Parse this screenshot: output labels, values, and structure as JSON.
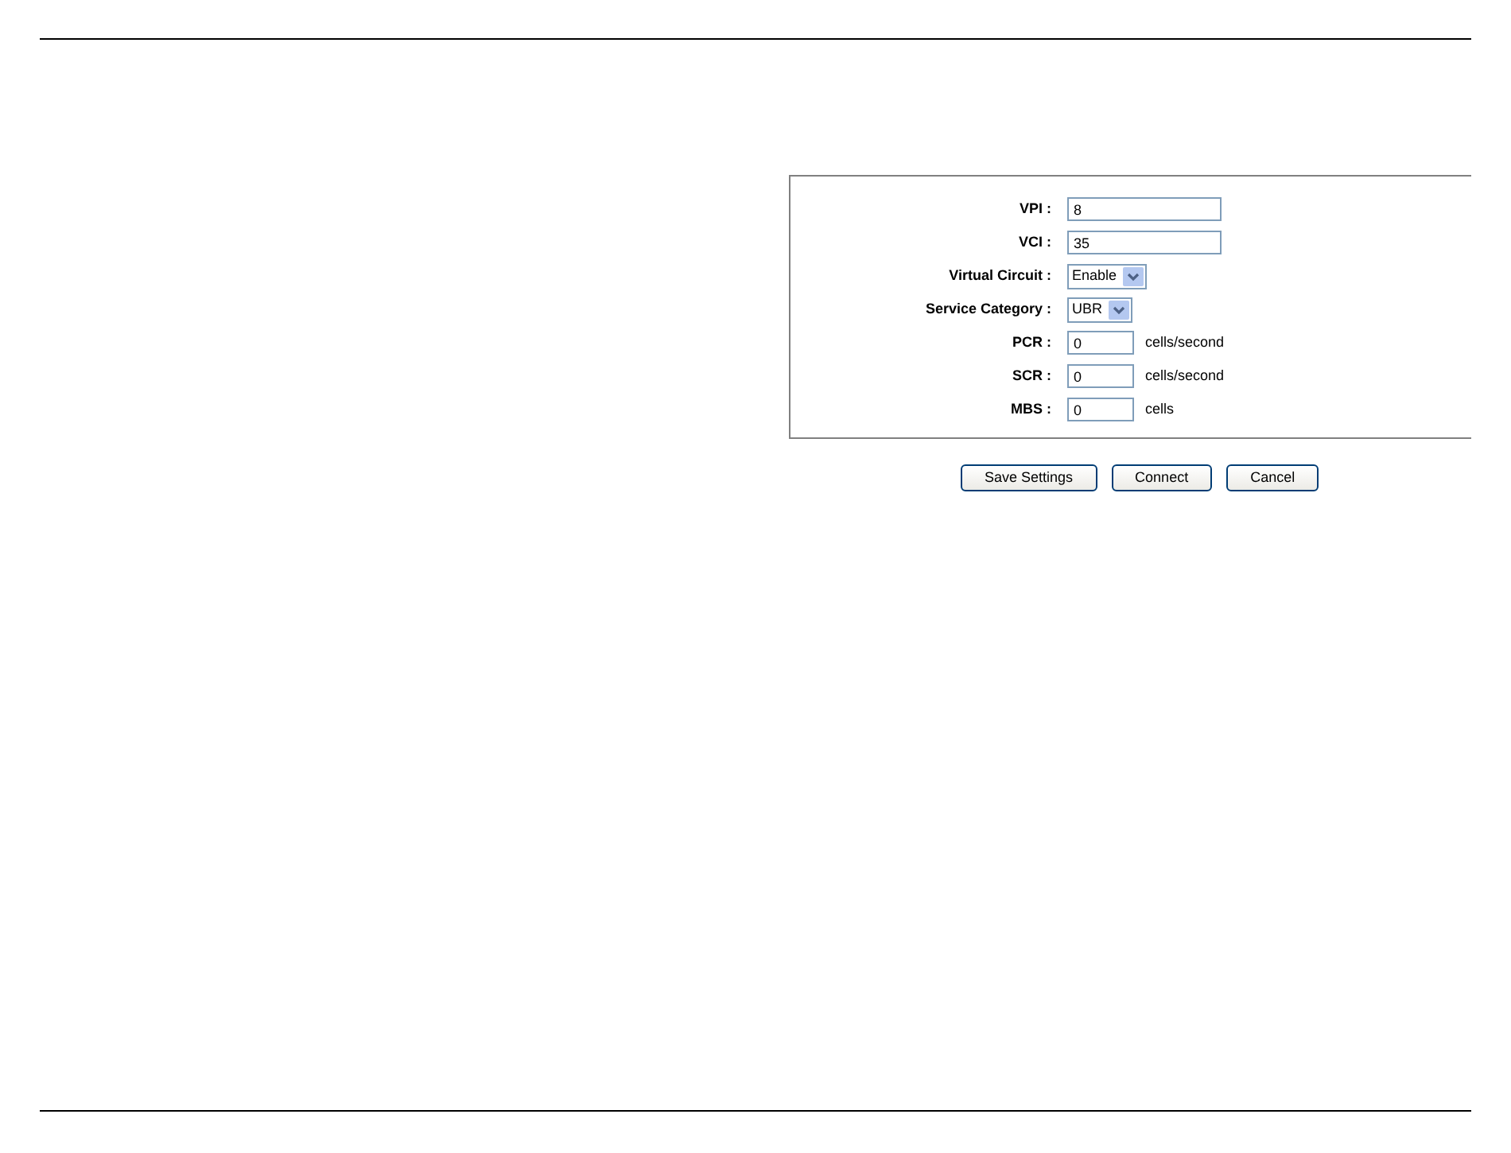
{
  "fields": [
    {
      "kind": "text",
      "label": "VPI :",
      "value": "8",
      "wide": true
    },
    {
      "kind": "text",
      "label": "VCI :",
      "value": "35",
      "wide": true
    },
    {
      "kind": "select",
      "label": "Virtual Circuit :",
      "value": "Enable"
    },
    {
      "kind": "select",
      "label": "Service Category :",
      "value": "UBR"
    },
    {
      "kind": "text",
      "label": "PCR :",
      "value": "0",
      "unit": "cells/second"
    },
    {
      "kind": "text",
      "label": "SCR :",
      "value": "0",
      "unit": "cells/second"
    },
    {
      "kind": "text",
      "label": "MBS :",
      "value": "0",
      "unit": "cells"
    }
  ],
  "buttons": [
    "Save Settings",
    "Connect",
    "Cancel"
  ]
}
